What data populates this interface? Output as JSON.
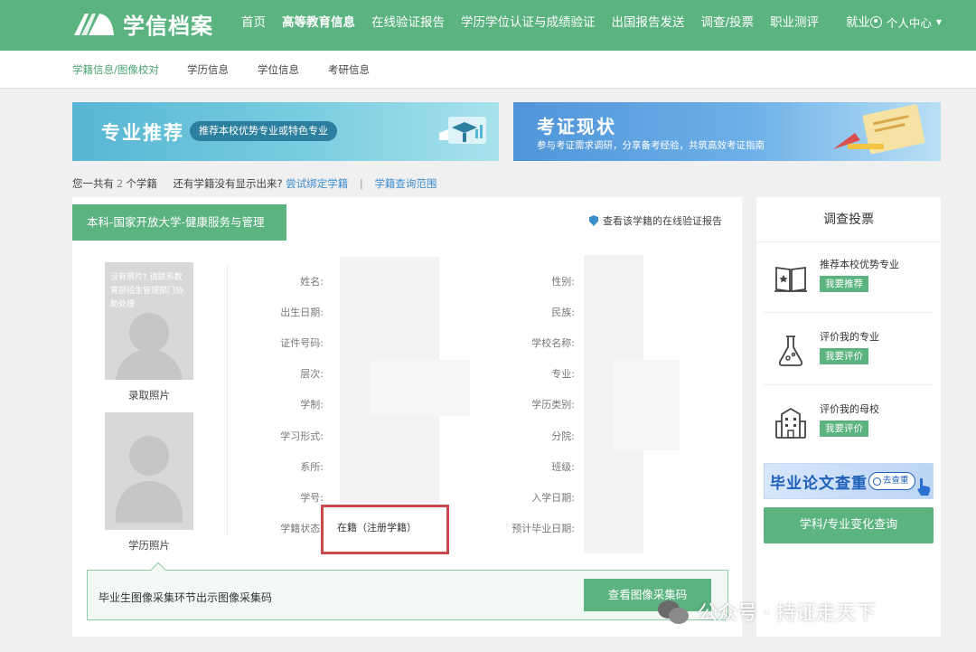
{
  "brand": {
    "name": "学信档案"
  },
  "nav": {
    "items": [
      {
        "label": "首页"
      },
      {
        "label": "高等教育信息",
        "active": true
      },
      {
        "label": "在线验证报告"
      },
      {
        "label": "学历学位认证与成绩验证"
      },
      {
        "label": "出国报告发送"
      },
      {
        "label": "调查/投票"
      },
      {
        "label": "职业测评"
      },
      {
        "label": "就业"
      }
    ],
    "user": "个人中心"
  },
  "subnav": {
    "items": [
      {
        "label": "学籍信息/图像校对",
        "active": true
      },
      {
        "label": "学历信息"
      },
      {
        "label": "学位信息"
      },
      {
        "label": "考研信息"
      }
    ]
  },
  "banners": {
    "left": {
      "title": "专业推荐",
      "pill": "推荐本校优势专业或特色专业"
    },
    "right": {
      "title": "考证现状",
      "subtitle": "参与考证需求调研，分享备考经验，共筑高效考证指南"
    }
  },
  "info": {
    "prefix": "您一共有",
    "count": "2",
    "suffix": "个学籍",
    "question": "还有学籍没有显示出来?",
    "bind_link": "尝试绑定学籍",
    "separator": "|",
    "scope_link": "学籍查询范围"
  },
  "record": {
    "tab": "本科-国家开放大学-健康服务与管理",
    "verify_link": "查看该学籍的在线验证报告",
    "photo_note": "没有照片? 请联系教育部招生管理部门协助处理",
    "photo_admission_label": "录取照片",
    "photo_degree_label": "学历照片",
    "fields_left": [
      "姓名:",
      "出生日期:",
      "证件号码:",
      "层次:",
      "学制:",
      "学习形式:",
      "系所:",
      "学号:",
      "学籍状态:"
    ],
    "fields_right": [
      "性别:",
      "民族:",
      "学校名称:",
      "专业:",
      "学历类别:",
      "分院:",
      "班级:",
      "入学日期:",
      "预计毕业日期:"
    ],
    "status_value": "在籍（注册学籍）",
    "bottom_text": "毕业生图像采集环节出示图像采集码",
    "bottom_button": "查看图像采集码"
  },
  "sidebar": {
    "title": "调查投票",
    "items": [
      {
        "label": "推荐本校优势专业",
        "button": "我要推荐",
        "icon": "book-icon"
      },
      {
        "label": "评价我的专业",
        "button": "我要评价",
        "icon": "flask-icon"
      },
      {
        "label": "评价我的母校",
        "button": "我要评价",
        "icon": "building-icon"
      }
    ],
    "thesis": {
      "title": "毕业论文查重",
      "pill": "去查重"
    },
    "change_button": "学科/专业变化查询"
  },
  "watermark": {
    "text": "公众号 · 持证走天下"
  },
  "colors": {
    "primary": "#5bb380",
    "link": "#3b8ccf",
    "highlight": "#c9494c"
  }
}
